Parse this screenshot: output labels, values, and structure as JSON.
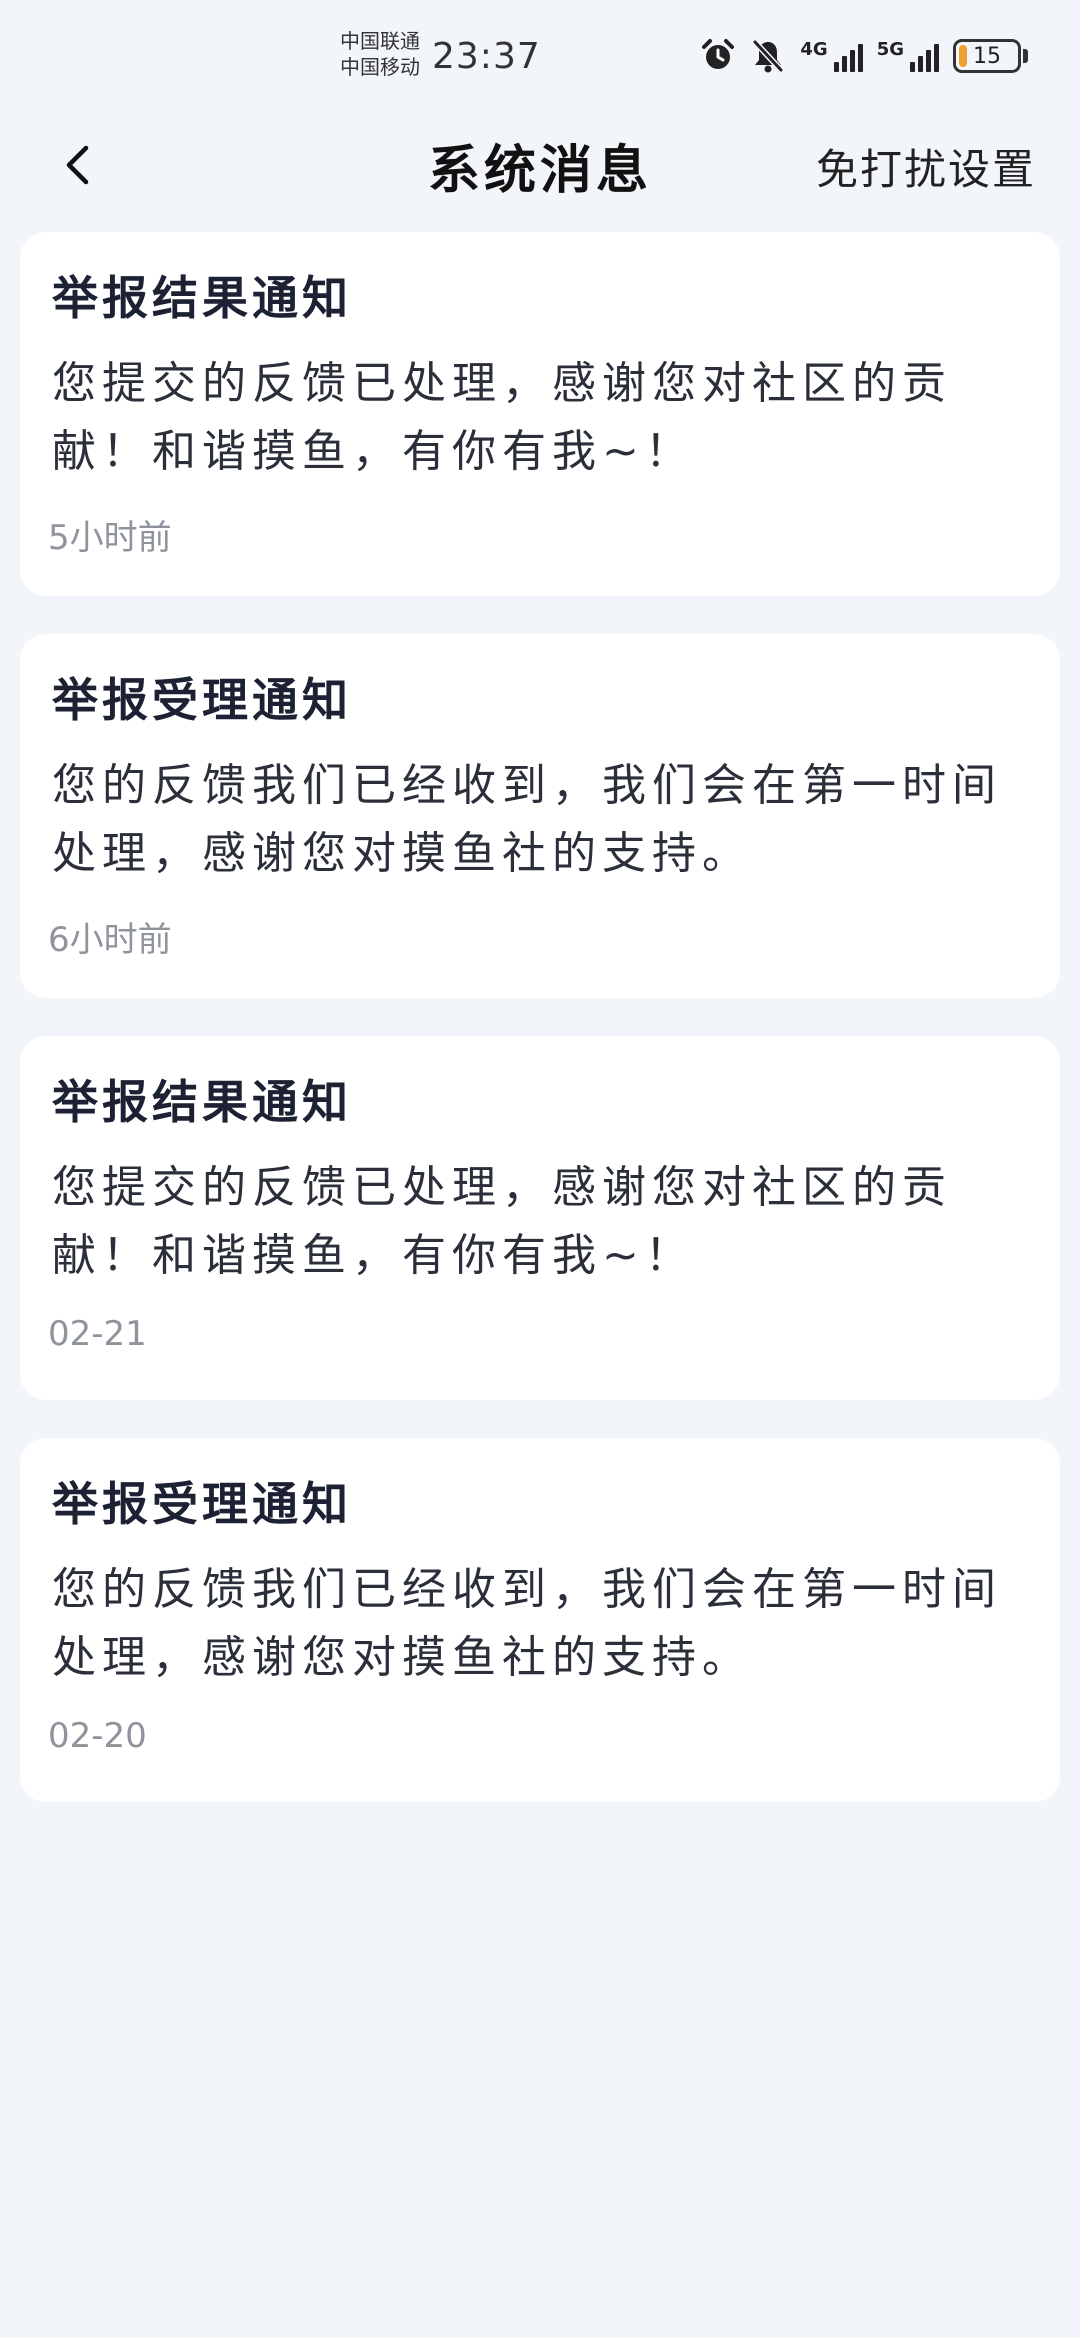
{
  "status_bar": {
    "carrier_1": "中国联通",
    "carrier_2": "中国移动",
    "time": "23:37",
    "net_4g": "4G",
    "net_5g": "5G",
    "battery": "15",
    "battery_level": 0.15,
    "battery_color": "#f0a030"
  },
  "header": {
    "title": "系统消息",
    "dnd_label": "免打扰设置",
    "back_icon": "chevron-left-icon"
  },
  "messages": [
    {
      "title": "举报结果通知",
      "body": "您提交的反馈已处理，感谢您对社区的贡献！和谐摸鱼，有你有我~！",
      "time": "5小时前"
    },
    {
      "title": "举报受理通知",
      "body": "您的反馈我们已经收到，我们会在第一时间处理，感谢您对摸鱼社的支持。",
      "time": "6小时前"
    },
    {
      "title": "举报结果通知",
      "body": "您提交的反馈已处理，感谢您对社区的贡献！和谐摸鱼，有你有我~！",
      "time": "02-21"
    },
    {
      "title": "举报受理通知",
      "body": "您的反馈我们已经收到，我们会在第一时间处理，感谢您对摸鱼社的支持。",
      "time": "02-20"
    }
  ]
}
